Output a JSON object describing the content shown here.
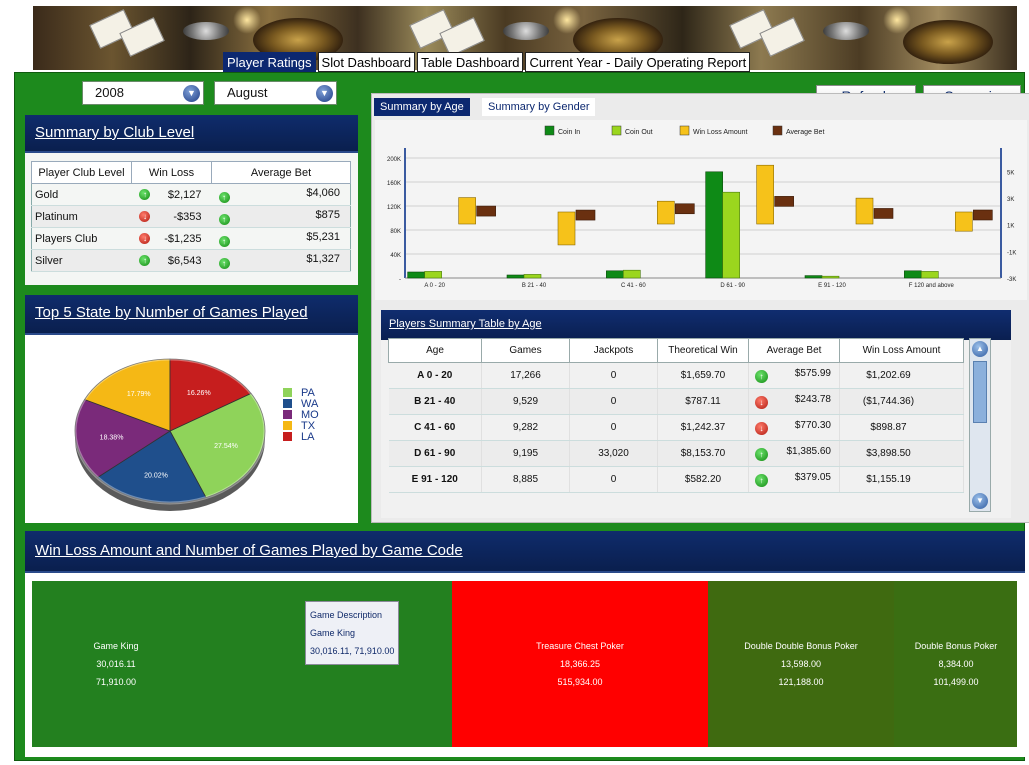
{
  "nav": {
    "tabs": [
      {
        "label": "Player Ratings",
        "active": true
      },
      {
        "label": "Slot Dashboard",
        "active": false
      },
      {
        "label": "Table Dashboard",
        "active": false
      },
      {
        "label": "Current Year - Daily Operating Report",
        "active": false
      }
    ]
  },
  "filters": {
    "year": "2008",
    "month": "August"
  },
  "actions": {
    "refresh": "Refresh",
    "scenario": "Scenario"
  },
  "club_summary": {
    "title": "Summary by Club Level",
    "columns": [
      "Player Club Level",
      "Win Loss",
      "Average Bet"
    ],
    "rows": [
      {
        "level": "Gold",
        "win_loss": "$2,127",
        "win_loss_status": "up",
        "avg_bet": "$4,060",
        "avg_bet_status": "up"
      },
      {
        "level": "Platinum",
        "win_loss": "-$353",
        "win_loss_status": "down",
        "avg_bet": "$875",
        "avg_bet_status": "up"
      },
      {
        "level": "Players Club",
        "win_loss": "-$1,235",
        "win_loss_status": "down",
        "avg_bet": "$5,231",
        "avg_bet_status": "up"
      },
      {
        "level": "Silver",
        "win_loss": "$6,543",
        "win_loss_status": "up",
        "avg_bet": "$1,327",
        "avg_bet_status": "up"
      }
    ]
  },
  "age_tabs": [
    "Summary by Age",
    "Summary by Gender"
  ],
  "pie": {
    "title": "Top 5 State by Number of Games Played",
    "chart_data": {
      "type": "pie",
      "categories": [
        "PA",
        "WA",
        "MO",
        "TX",
        "LA"
      ],
      "values": [
        27.54,
        20.02,
        18.38,
        17.79,
        16.26
      ],
      "labels": [
        "27.54%",
        "20.02%",
        "18.38%",
        "17.79%",
        "16.26%"
      ],
      "colors": [
        "#8fd35a",
        "#1f4f8c",
        "#7a2a7a",
        "#f5b815",
        "#c61e1e"
      ],
      "legend": "right"
    }
  },
  "bar_chart": {
    "chart_data": {
      "type": "bar",
      "categories": [
        "A 0 - 20",
        "B 21 - 40",
        "C 41 - 60",
        "D 61 - 90",
        "E 91 - 120",
        "F 120 and above"
      ],
      "series": [
        {
          "name": "Coin In",
          "axis": "left",
          "values": [
            10000,
            5000,
            12000,
            177000,
            4000,
            12000
          ],
          "color": "#0e8a16"
        },
        {
          "name": "Coin Out",
          "axis": "left",
          "values": [
            11000,
            6000,
            13000,
            143000,
            3000,
            11000
          ],
          "color": "#9bd61e"
        },
        {
          "name": "Win Loss Amount",
          "axis": "right",
          "type": "floating",
          "values": [
            1202.69,
            -1744.36,
            898.87,
            3898.5,
            1155.19,
            -600
          ],
          "color": "#f6c21a"
        },
        {
          "name": "Average Bet",
          "axis": "right",
          "type": "floating",
          "values": [
            575.99,
            243.78,
            770.3,
            1385.6,
            379.05,
            250
          ],
          "color": "#6a3010"
        }
      ],
      "left_ticks": [
        "-",
        "40K",
        "80K",
        "120K",
        "160K",
        "200K"
      ],
      "right_ticks": [
        "-3K",
        "-1K",
        "1K",
        "3K",
        "5K"
      ],
      "legend": "top",
      "grid": true
    }
  },
  "age_summary": {
    "title": "Players Summary Table by Age",
    "columns": [
      "Age",
      "Games",
      "Jackpots",
      "Theoretical Win",
      "Average Bet",
      "Win Loss Amount"
    ],
    "rows": [
      {
        "age": "A 0 - 20",
        "games": "17,266",
        "jackpots": "0",
        "theo_win": "$1,659.70",
        "avg_bet": "$575.99",
        "avg_status": "up",
        "win_loss": "$1,202.69"
      },
      {
        "age": "B 21 - 40",
        "games": "9,529",
        "jackpots": "0",
        "theo_win": "$787.11",
        "avg_bet": "$243.78",
        "avg_status": "down",
        "win_loss": "($1,744.36)"
      },
      {
        "age": "C 41 - 60",
        "games": "9,282",
        "jackpots": "0",
        "theo_win": "$1,242.37",
        "avg_bet": "$770.30",
        "avg_status": "down",
        "win_loss": "$898.87"
      },
      {
        "age": "D 61 - 90",
        "games": "9,195",
        "jackpots": "33,020",
        "theo_win": "$8,153.70",
        "avg_bet": "$1,385.60",
        "avg_status": "up",
        "win_loss": "$3,898.50"
      },
      {
        "age": "E 91 - 120",
        "games": "8,885",
        "jackpots": "0",
        "theo_win": "$582.20",
        "avg_bet": "$379.05",
        "avg_status": "up",
        "win_loss": "$1,155.19"
      }
    ]
  },
  "game_code": {
    "title": "Win Loss Amount and Number of Games Played by Game Code",
    "blocks": [
      {
        "name": "Game King",
        "v1": "30,016.11",
        "v2": "71,910.00",
        "color": "#23801f"
      },
      {
        "name": "Treasure Chest Poker",
        "v1": "18,366.25",
        "v2": "515,934.00",
        "color": "#ff0000"
      },
      {
        "name": "Double Double Bonus Poker",
        "v1": "13,598.00",
        "v2": "121,188.00",
        "color": "#3f6a10"
      },
      {
        "name": "Double Bonus Poker",
        "v1": "8,384.00",
        "v2": "101,499.00",
        "color": "#3a6e12"
      }
    ],
    "tooltip": {
      "heading": "Game Description",
      "name": "Game King",
      "values": "30,016.11, 71,910.00"
    }
  }
}
